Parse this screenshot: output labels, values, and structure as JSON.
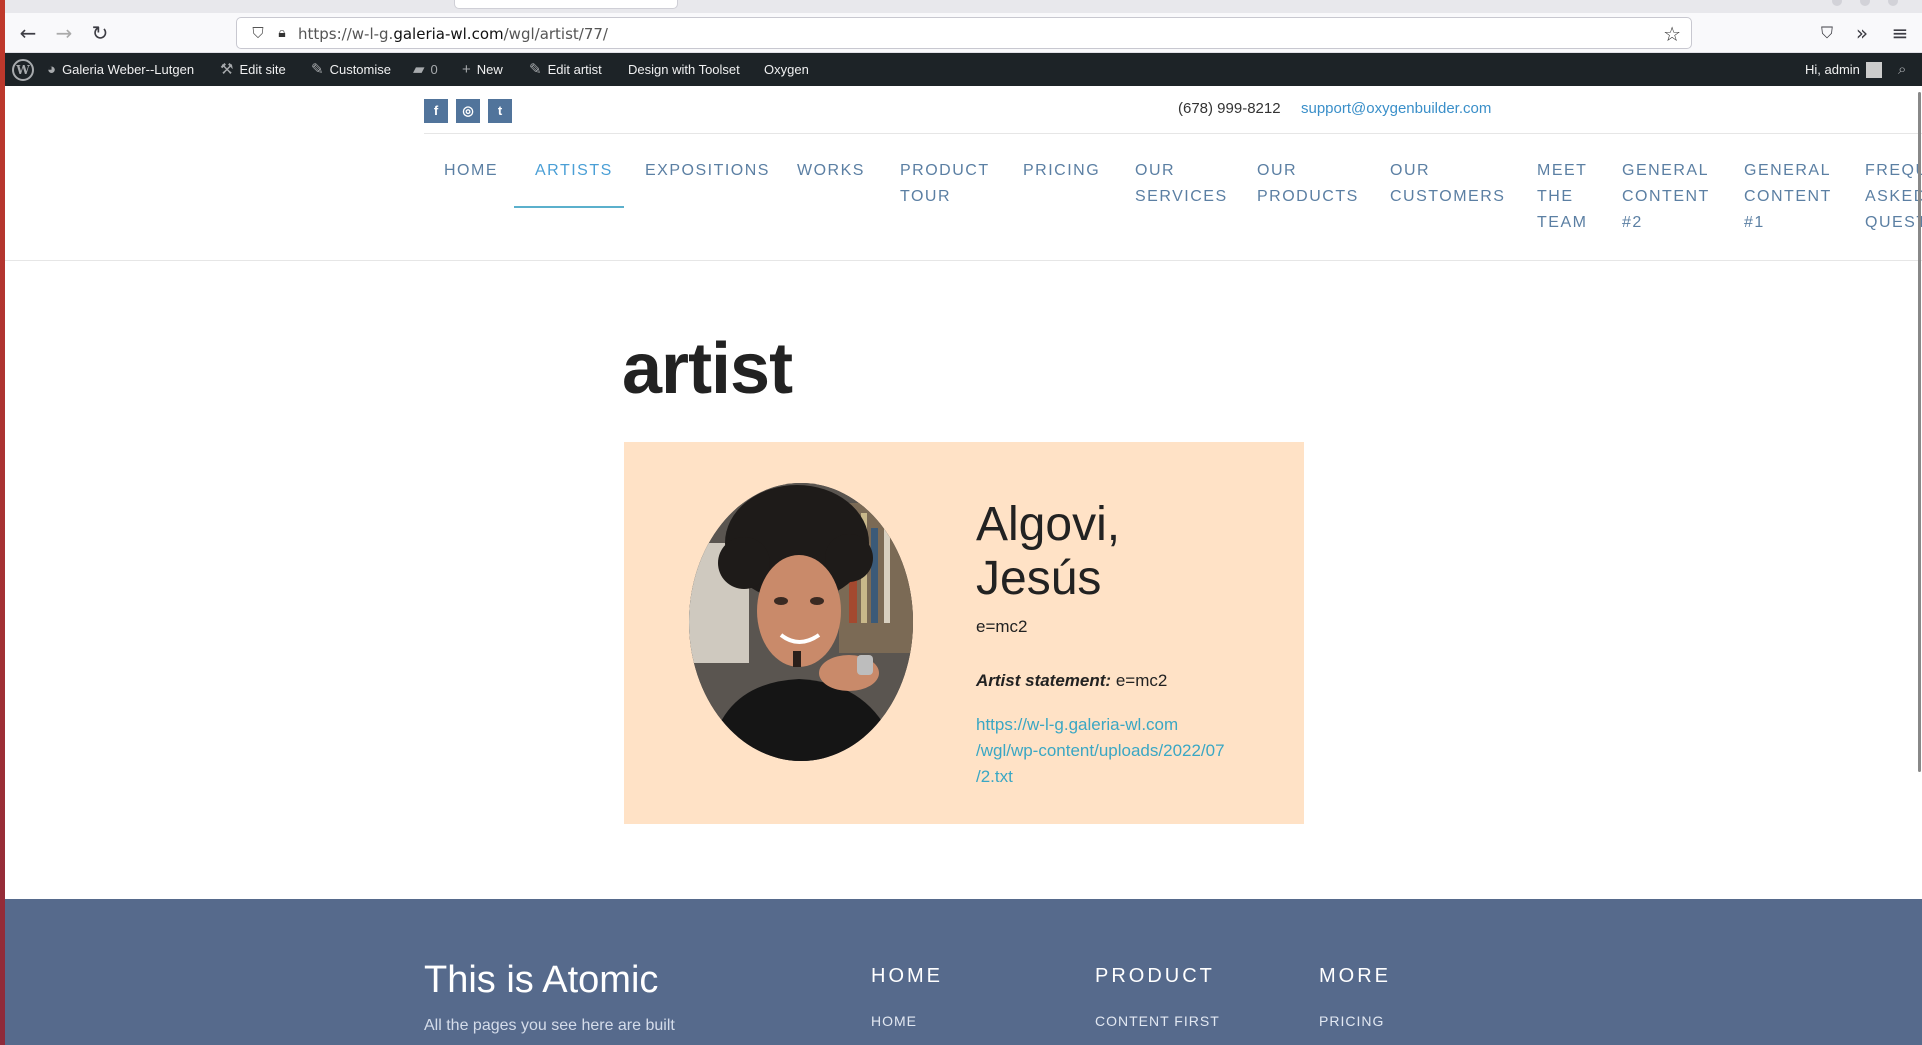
{
  "browser": {
    "url_prefix": "https://w-l-g.",
    "url_domain": "galeria-wl.com",
    "url_path": "/wgl/artist/77/",
    "icons": [
      "back-icon",
      "forward-icon",
      "reload-icon",
      "shield-icon",
      "lock-icon",
      "star-icon",
      "pocket-icon",
      "more-tools-icon",
      "menu-icon"
    ]
  },
  "adminbar": {
    "site_name": "Galeria Weber--Lutgen",
    "edit_site": "Edit site",
    "customise": "Customise",
    "comments_count": "0",
    "new": "New",
    "edit_artist": "Edit artist",
    "toolset": "Design with Toolset",
    "oxygen": "Oxygen",
    "greeting": "Hi, admin"
  },
  "header": {
    "phone": "(678) 999-8212",
    "email": "support@oxygenbuilder.com",
    "social": [
      {
        "icon": "facebook-icon",
        "glyph": "f"
      },
      {
        "icon": "instagram-icon",
        "glyph": "◎"
      },
      {
        "icon": "twitter-icon",
        "glyph": "t"
      }
    ]
  },
  "nav": {
    "items": [
      {
        "line1": "HOME",
        "line2": "",
        "line3": ""
      },
      {
        "line1": "ARTISTS",
        "line2": "",
        "line3": ""
      },
      {
        "line1": "EXPOSITIONS",
        "line2": "",
        "line3": ""
      },
      {
        "line1": "WORKS",
        "line2": "",
        "line3": ""
      },
      {
        "line1": "PRODUCT",
        "line2": "TOUR",
        "line3": ""
      },
      {
        "line1": "PRICING",
        "line2": "",
        "line3": ""
      },
      {
        "line1": "OUR",
        "line2": "SERVICES",
        "line3": ""
      },
      {
        "line1": "OUR",
        "line2": "PRODUCTS",
        "line3": ""
      },
      {
        "line1": "OUR",
        "line2": "CUSTOMERS",
        "line3": ""
      },
      {
        "line1": "MEET",
        "line2": "THE",
        "line3": "TEAM"
      },
      {
        "line1": "GENERAL",
        "line2": "CONTENT",
        "line3": "#2"
      },
      {
        "line1": "GENERAL",
        "line2": "CONTENT",
        "line3": "#1"
      },
      {
        "line1": "FREQU",
        "line2": "ASKED",
        "line3": "QUEST"
      }
    ],
    "active": "ARTISTS"
  },
  "main": {
    "page_title": "artist",
    "artist": {
      "name_line1": "Algovi,",
      "name_line2": "Jesús",
      "short_text": "e=mc2",
      "statement_label": "Artist statement:",
      "statement_value": "e=mc2",
      "link_line1": "https://w-l-g.galeria-wl.com",
      "link_line2": "/wgl/wp-content/uploads/2022/07",
      "link_line3": "/2.txt"
    },
    "card_color": "#ffe2c6"
  },
  "footer": {
    "title": "This is Atomic",
    "text": "All the pages you see here are built",
    "columns": [
      {
        "heading": "HOME",
        "link": "HOME"
      },
      {
        "heading": "PRODUCT",
        "link": "CONTENT FIRST"
      },
      {
        "heading": "MORE",
        "link": "PRICING"
      }
    ],
    "bg_color": "#566a8c"
  }
}
